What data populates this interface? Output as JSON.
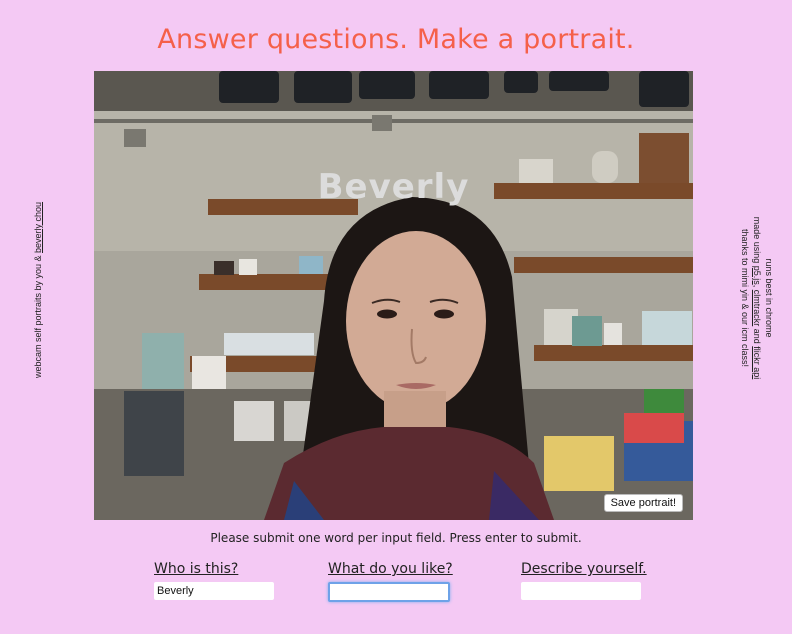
{
  "title": "Answer questions. Make a portrait.",
  "side_left": {
    "prefix": "webcam self portraits by you & ",
    "author_link": "beverly chou"
  },
  "side_right": {
    "line1": "runs best in chrome",
    "line2_prefix": "made using ",
    "link_p5": "p5.js",
    "sep1": ", ",
    "link_clm": "clmtrackr",
    "sep2": " and ",
    "link_flickr": "flickr api",
    "line3": "thanks to mimi yin & our icm class!"
  },
  "webcam": {
    "overlay_word": "Beverly",
    "save_button": "Save portrait!"
  },
  "instructions": "Please submit one word per input field. Press enter to submit.",
  "fields": [
    {
      "label": "Who is this?",
      "value": "Beverly"
    },
    {
      "label": "What do you like?",
      "value": ""
    },
    {
      "label": "Describe yourself.",
      "value": ""
    }
  ],
  "colors": {
    "background": "#f4c9f4",
    "title": "#f5604a",
    "focus_ring": "#6ea2e8"
  }
}
